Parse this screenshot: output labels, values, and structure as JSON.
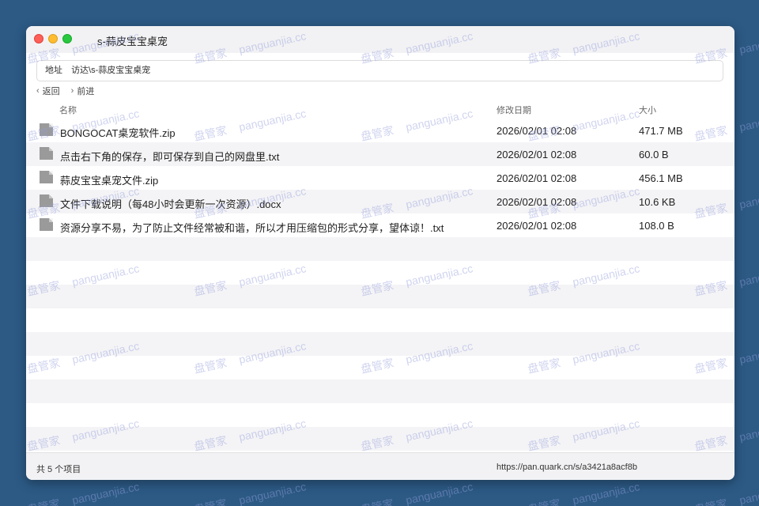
{
  "window": {
    "title": "s-蒜皮宝宝桌宠",
    "traffic_lights": [
      "close",
      "minimize",
      "zoom"
    ]
  },
  "address": {
    "label": "地址",
    "path": "访达\\s-蒜皮宝宝桌宠"
  },
  "nav": {
    "back_label": "返回",
    "forward_label": "前进"
  },
  "columns": {
    "name": "名称",
    "modified": "修改日期",
    "size": "大小"
  },
  "files": [
    {
      "name": "BONGOCAT桌宠软件.zip",
      "modified": "2026/02/01 02:08",
      "size": "471.7 MB",
      "icon": "file-icon"
    },
    {
      "name": "点击右下角的保存，即可保存到自己的网盘里.txt",
      "modified": "2026/02/01 02:08",
      "size": "60.0 B",
      "icon": "file-icon"
    },
    {
      "name": "蒜皮宝宝桌宠文件.zip",
      "modified": "2026/02/01 02:08",
      "size": "456.1 MB",
      "icon": "file-icon"
    },
    {
      "name": "文件下载说明（每48小时会更新一次资源）.docx",
      "modified": "2026/02/01 02:08",
      "size": "10.6 KB",
      "icon": "file-icon"
    },
    {
      "name": "资源分享不易，为了防止文件经常被和谐，所以才用压缩包的形式分享，望体谅！.txt",
      "modified": "2026/02/01 02:08",
      "size": "108.0 B",
      "icon": "file-icon"
    }
  ],
  "status": {
    "count": "共 5 个项目",
    "link": "https://pan.quark.cn/s/a3421a8acf8b"
  },
  "watermark": {
    "cn": "盘管家",
    "en": "panguanjia.cc"
  },
  "colors": {
    "desktop": "#2c5a85",
    "window": "#ffffff",
    "stripe": "#f4f4f6"
  }
}
